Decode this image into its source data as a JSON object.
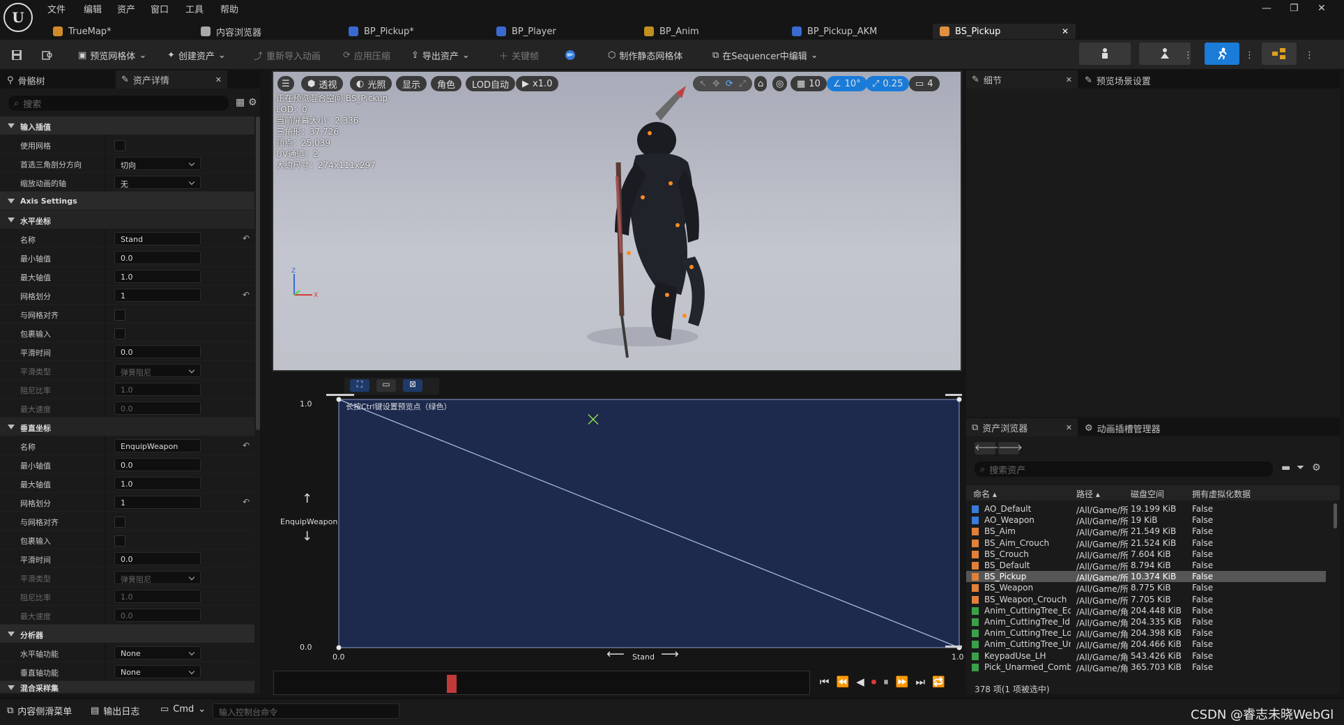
{
  "menu": [
    "文件",
    "编辑",
    "资产",
    "窗口",
    "工具",
    "帮助"
  ],
  "logo": "U",
  "tabs": [
    {
      "label": "TrueMap*",
      "color": "#d08a2a"
    },
    {
      "label": "内容浏览器",
      "color": "#aaaaaa"
    },
    {
      "label": "BP_Pickup*",
      "color": "#3a6ad0"
    },
    {
      "label": "BP_Player",
      "color": "#3a6ad0"
    },
    {
      "label": "BP_Anim",
      "color": "#c09020"
    },
    {
      "label": "BP_Pickup_AKM",
      "color": "#3a6ad0"
    },
    {
      "label": "BS_Pickup",
      "color": "#e09040",
      "active": true
    }
  ],
  "toolbar": {
    "preview_mesh": "预览网格体",
    "create_asset": "创建资产",
    "reimport": "重新导入动画",
    "apply_compress": "应用压缩",
    "export_asset": "导出资产",
    "keyframe": "关键帧",
    "make_static_mesh": "制作静态网格体",
    "edit_in_sequencer": "在Sequencer中编辑"
  },
  "left": {
    "tab_skeleton": "骨骼树",
    "tab_asset_details": "资产详情",
    "search_placeholder": "搜索",
    "sections": {
      "input_interp": "输入插值",
      "axis_settings": "Axis Settings",
      "horizontal": "水平坐标",
      "vertical": "垂直坐标",
      "analyzer": "分析器",
      "mix_samples": "混合采样集"
    },
    "rows": {
      "use_grid": "使用网格",
      "pref_tri": "首选三角剖分方向",
      "pref_tri_val": "切向",
      "scale_axis": "缩放动画的轴",
      "scale_axis_val": "无",
      "name": "名称",
      "h_name_val": "Stand",
      "v_name_val": "EnquipWeapon",
      "min": "最小轴值",
      "max": "最大轴值",
      "min_val": "0.0",
      "max_val": "1.0",
      "grid_div": "网格划分",
      "grid_div_val": "1",
      "snap": "与网格对齐",
      "wrap": "包裹输入",
      "smooth_time": "平滑时间",
      "smooth_time_val": "0.0",
      "smooth_type": "平滑类型",
      "smooth_type_val": "弹簧阻尼",
      "damping": "阻尼比率",
      "damping_val": "1.0",
      "max_speed": "最大速度",
      "max_speed_val": "0.0",
      "h_func": "水平轴功能",
      "v_func": "垂直轴功能",
      "none": "None"
    }
  },
  "viewport": {
    "perspective": "透视",
    "lit": "光照",
    "show": "显示",
    "character": "角色",
    "lod": "LOD自动",
    "play": "x1.0",
    "grid": "10",
    "angle": "10°",
    "scale": "0.25",
    "cam": "4",
    "info": [
      "正在预览混合空间 BS_Pickup",
      "LOD：0",
      "当前屏幕大小：2.336",
      "三角形：37,726",
      "顶点：25,039",
      "UV通道：2",
      "大约尺寸：274x111x297"
    ]
  },
  "blendspace": {
    "hint": "长按Ctrl键设置预览点（绿色）",
    "y_max": "1.0",
    "y_min": "0.0",
    "x_min": "0.0",
    "x_max": "1.0",
    "y_label": "EnquipWeapon",
    "x_label": "Stand",
    "preview_point": [
      0.41,
      0.92
    ]
  },
  "right": {
    "tab_details": "细节",
    "tab_preview_settings": "预览场景设置"
  },
  "asset_browser": {
    "tab": "资产浏览器",
    "tab2": "动画插槽管理器",
    "search_placeholder": "搜索资产",
    "headers": [
      "命名",
      "路径",
      "磁盘空间",
      "拥有虚拟化数据"
    ],
    "rows": [
      {
        "name": "AO_Default",
        "path": "/All/Game/所有",
        "size": "19.199 KiB",
        "virt": "False",
        "color": "#3a7ad8"
      },
      {
        "name": "AO_Weapon",
        "path": "/All/Game/所有",
        "size": "19 KiB",
        "virt": "False",
        "color": "#3a7ad8"
      },
      {
        "name": "BS_Aim",
        "path": "/All/Game/所有",
        "size": "21.549 KiB",
        "virt": "False",
        "color": "#e0803a"
      },
      {
        "name": "BS_Aim_Crouch",
        "path": "/All/Game/所有",
        "size": "21.524 KiB",
        "virt": "False",
        "color": "#e0803a"
      },
      {
        "name": "BS_Crouch",
        "path": "/All/Game/所有",
        "size": "7.604 KiB",
        "virt": "False",
        "color": "#e0803a"
      },
      {
        "name": "BS_Default",
        "path": "/All/Game/所有",
        "size": "8.794 KiB",
        "virt": "False",
        "color": "#e0803a"
      },
      {
        "name": "BS_Pickup",
        "path": "/All/Game/所有",
        "size": "10.374 KiB",
        "virt": "False",
        "color": "#e0803a",
        "selected": true
      },
      {
        "name": "BS_Weapon",
        "path": "/All/Game/所有",
        "size": "8.775 KiB",
        "virt": "False",
        "color": "#e0803a"
      },
      {
        "name": "BS_Weapon_Crouch",
        "path": "/All/Game/所有",
        "size": "7.705 KiB",
        "virt": "False",
        "color": "#e0803a"
      },
      {
        "name": "Anim_CuttingTree_Equip",
        "path": "/All/Game/角色",
        "size": "204.448 KiB",
        "virt": "False",
        "color": "#3aa04a"
      },
      {
        "name": "Anim_CuttingTree_Idle",
        "path": "/All/Game/角色",
        "size": "204.335 KiB",
        "virt": "False",
        "color": "#3aa04a"
      },
      {
        "name": "Anim_CuttingTree_Loop",
        "path": "/All/Game/角色",
        "size": "204.398 KiB",
        "virt": "False",
        "color": "#3aa04a"
      },
      {
        "name": "Anim_CuttingTree_UnEquip",
        "path": "/All/Game/角色",
        "size": "204.466 KiB",
        "virt": "False",
        "color": "#3aa04a"
      },
      {
        "name": "KeypadUse_LH",
        "path": "/All/Game/角色",
        "size": "543.426 KiB",
        "virt": "False",
        "color": "#3aa04a"
      },
      {
        "name": "Pick_Unarmed_Combat_Sta",
        "path": "/All/Game/角色",
        "size": "365.703 KiB",
        "virt": "False",
        "color": "#3aa04a"
      }
    ],
    "count": "378 项(1 项被选中)"
  },
  "bottom": {
    "content_drawer": "内容侧滑菜单",
    "output_log": "输出日志",
    "cmd": "Cmd",
    "console_placeholder": "输入控制台命令",
    "watermark": "CSDN @睿志未晓WebGl"
  }
}
